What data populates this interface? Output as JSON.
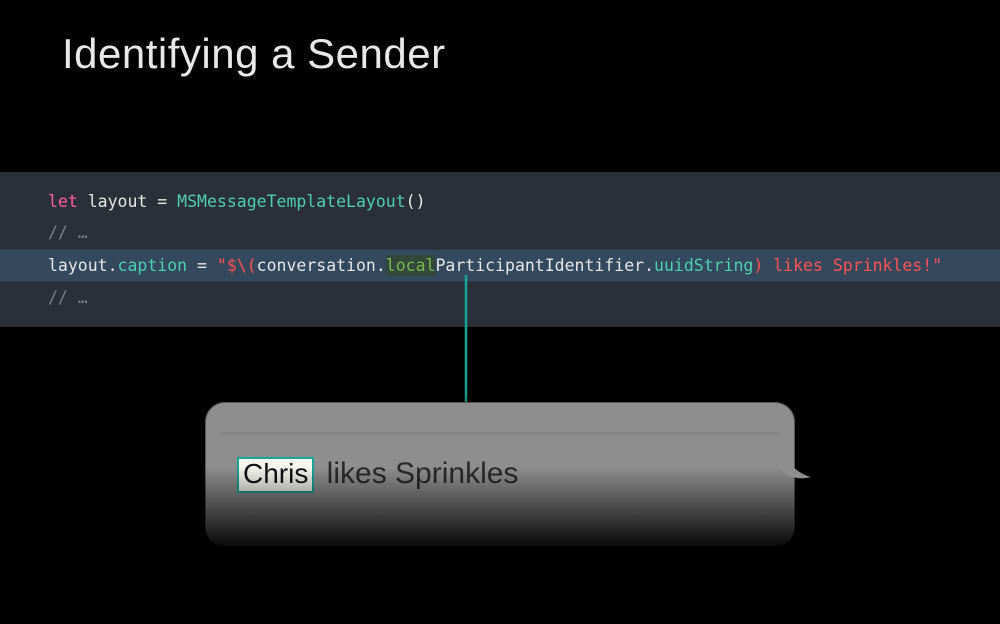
{
  "title": "Identifying a Sender",
  "code": {
    "line1_kw": "let",
    "line1_name": " layout ",
    "line1_eq": "= ",
    "line1_type": "MSMessageTemplateLayout",
    "line1_call": "()",
    "line2_comment": "// …",
    "line3_lhs": "layout.",
    "line3_prop": "caption",
    "line3_mid": " = ",
    "line3_str_open": "\"$\\(",
    "line3_expr_pre": "conversation.",
    "line3_hl": "local",
    "line3_expr_post": "ParticipantIdentifier",
    "line3_dot": ".",
    "line3_uuid": "uuidString",
    "line3_close": ")",
    "line3_str_tail": " likes Sprinkles!\"",
    "line4_comment": "// …"
  },
  "bubble": {
    "sender": "Chris",
    "rest": " likes Sprinkles"
  },
  "colors": {
    "accent": "#19a394"
  }
}
